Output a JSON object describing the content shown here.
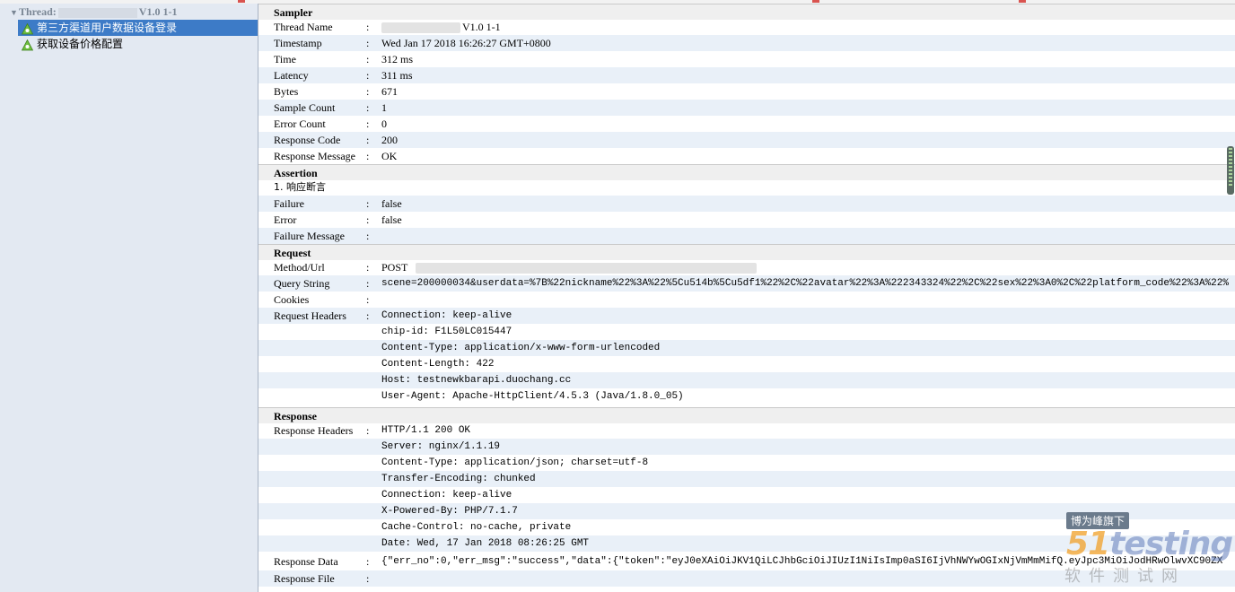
{
  "tree": {
    "root": {
      "label_prefix": "Thread:",
      "label_suffix": "V1.0 1-1"
    },
    "items": [
      {
        "label": "第三方渠道用户数据设备登录",
        "selected": true
      },
      {
        "label": "获取设备价格配置",
        "selected": false
      }
    ]
  },
  "sampler": {
    "title": "Sampler",
    "rows": [
      {
        "key": "Thread Name",
        "value": "V1.0 1-1",
        "mono": false
      },
      {
        "key": "Timestamp",
        "value": "Wed Jan 17 2018 16:26:27 GMT+0800",
        "mono": false
      },
      {
        "key": "Time",
        "value": "312 ms",
        "mono": false
      },
      {
        "key": "Latency",
        "value": "311 ms",
        "mono": false
      },
      {
        "key": "Bytes",
        "value": "671",
        "mono": false
      },
      {
        "key": "Sample Count",
        "value": "1",
        "mono": false
      },
      {
        "key": "Error Count",
        "value": "0",
        "mono": false
      },
      {
        "key": "Response Code",
        "value": "200",
        "mono": false
      },
      {
        "key": "Response Message",
        "value": "OK",
        "mono": false
      }
    ]
  },
  "assertion": {
    "title": "Assertion",
    "name": "1. 响应断言",
    "rows": [
      {
        "key": "Failure",
        "value": "false",
        "mono": false
      },
      {
        "key": "Error",
        "value": "false",
        "mono": false
      },
      {
        "key": "Failure Message",
        "value": "",
        "mono": false
      }
    ]
  },
  "request": {
    "title": "Request",
    "rows": [
      {
        "key": "Method/Url",
        "value": "POST",
        "mono": false
      },
      {
        "key": "Query String",
        "value": "scene=200000034&userdata=%7B%22nickname%22%3A%22%5Cu514b%5Cu5df1%22%2C%22avatar%22%3A%222343324%22%2C%22sex%22%3A0%2C%22platform_code%22%3A%22%",
        "mono": true
      },
      {
        "key": "Cookies",
        "value": "",
        "mono": false
      },
      {
        "key": "Request Headers",
        "value": "Connection: keep-alive",
        "mono": true
      },
      {
        "key": "",
        "value": "chip-id: F1L50LC015447",
        "mono": true
      },
      {
        "key": "",
        "value": "Content-Type: application/x-www-form-urlencoded",
        "mono": true
      },
      {
        "key": "",
        "value": "Content-Length: 422",
        "mono": true
      },
      {
        "key": "",
        "value": "Host: testnewkbarapi.duochang.cc",
        "mono": true
      },
      {
        "key": "",
        "value": "User-Agent: Apache-HttpClient/4.5.3 (Java/1.8.0_05)",
        "mono": true
      }
    ]
  },
  "response": {
    "title": "Response",
    "rows": [
      {
        "key": "Response Headers",
        "value": "HTTP/1.1 200 OK",
        "mono": true
      },
      {
        "key": "",
        "value": "Server: nginx/1.1.19",
        "mono": true
      },
      {
        "key": "",
        "value": "Content-Type: application/json; charset=utf-8",
        "mono": true
      },
      {
        "key": "",
        "value": "Transfer-Encoding: chunked",
        "mono": true
      },
      {
        "key": "",
        "value": "Connection: keep-alive",
        "mono": true
      },
      {
        "key": "",
        "value": "X-Powered-By: PHP/7.1.7",
        "mono": true
      },
      {
        "key": "",
        "value": "Cache-Control: no-cache, private",
        "mono": true
      },
      {
        "key": "",
        "value": "Date: Wed, 17 Jan 2018 08:26:25 GMT",
        "mono": true
      },
      {
        "key": "Response Data",
        "value": "{\"err_no\":0,\"err_msg\":\"success\",\"data\":{\"token\":\"eyJ0eXAiOiJKV1QiLCJhbGciOiJIUzI1NiIsImp0aSI6IjVhNWYwOGIxNjVmMmMifQ.eyJpc3MiOiJodHRwOlwvXC90ZX",
        "mono": true
      },
      {
        "key": "Response File",
        "value": "",
        "mono": false
      }
    ]
  },
  "separator": ":",
  "watermark": {
    "tag": "博为峰旗下",
    "logo_num": "51",
    "logo_text": "testing",
    "sub": "软件测试网"
  },
  "colors": {
    "selected": "#3d7bc7",
    "alt_row": "#e9f0f8",
    "tree_bg": "#e3e9f2"
  }
}
